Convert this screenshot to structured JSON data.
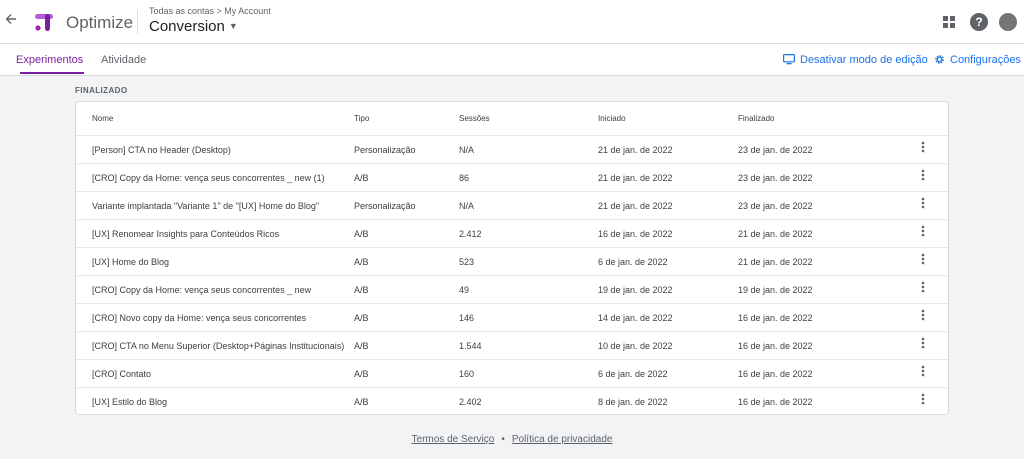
{
  "app": {
    "product": "Optimize"
  },
  "header": {
    "breadcrumb": "Todas as contas > My Account",
    "container": "Conversion",
    "avatar_initial": "",
    "help_glyph": "?"
  },
  "tabs": [
    {
      "label": "Experimentos",
      "active": true
    },
    {
      "label": "Atividade",
      "active": false
    }
  ],
  "actions": {
    "disable_edit": "Desativar modo de edição",
    "settings": "Configurações"
  },
  "section": {
    "title": "FINALIZADO"
  },
  "table": {
    "columns": [
      "Nome",
      "Tipo",
      "Sessões",
      "Iniciado",
      "Finalizado"
    ],
    "rows": [
      [
        "[Person] CTA no Header (Desktop)",
        "Personalização",
        "N/A",
        "21 de jan. de 2022",
        "23 de jan. de 2022"
      ],
      [
        "[CRO] Copy da Home: vença seus concorrentes _ new (1)",
        "A/B",
        "86",
        "21 de jan. de 2022",
        "23 de jan. de 2022"
      ],
      [
        "Variante implantada \"Variante 1\" de \"[UX] Home do Blog\"",
        "Personalização",
        "N/A",
        "21 de jan. de 2022",
        "23 de jan. de 2022"
      ],
      [
        "[UX] Renomear Insights para Conteúdos Ricos",
        "A/B",
        "2.412",
        "16 de jan. de 2022",
        "21 de jan. de 2022"
      ],
      [
        "[UX] Home do Blog",
        "A/B",
        "523",
        "6 de jan. de 2022",
        "21 de jan. de 2022"
      ],
      [
        "[CRO] Copy da Home: vença seus concorrentes _ new",
        "A/B",
        "49",
        "19 de jan. de 2022",
        "19 de jan. de 2022"
      ],
      [
        "[CRO] Novo copy da Home: vença seus concorrentes",
        "A/B",
        "146",
        "14 de jan. de 2022",
        "16 de jan. de 2022"
      ],
      [
        "[CRO] CTA no Menu Superior (Desktop+Páginas Institucionais)",
        "A/B",
        "1.544",
        "10 de jan. de 2022",
        "16 de jan. de 2022"
      ],
      [
        "[CRO] Contato",
        "A/B",
        "160",
        "6 de jan. de 2022",
        "16 de jan. de 2022"
      ],
      [
        "[UX] Estilo do Blog",
        "A/B",
        "2.402",
        "8 de jan. de 2022",
        "16 de jan. de 2022"
      ]
    ]
  },
  "footer": {
    "terms": "Termos de Serviço",
    "separator": "•",
    "privacy": "Política de privacidade"
  },
  "colors": {
    "accent": "#7b1fa2",
    "link": "#1a73e8",
    "background": "#f1f3f4"
  },
  "icons": [
    "back-arrow-icon",
    "optimize-logo-icon",
    "caret-down-icon",
    "apps-grid-icon",
    "help-icon",
    "avatar",
    "desktop-edit-icon",
    "gear-icon",
    "more-vert-icon"
  ]
}
